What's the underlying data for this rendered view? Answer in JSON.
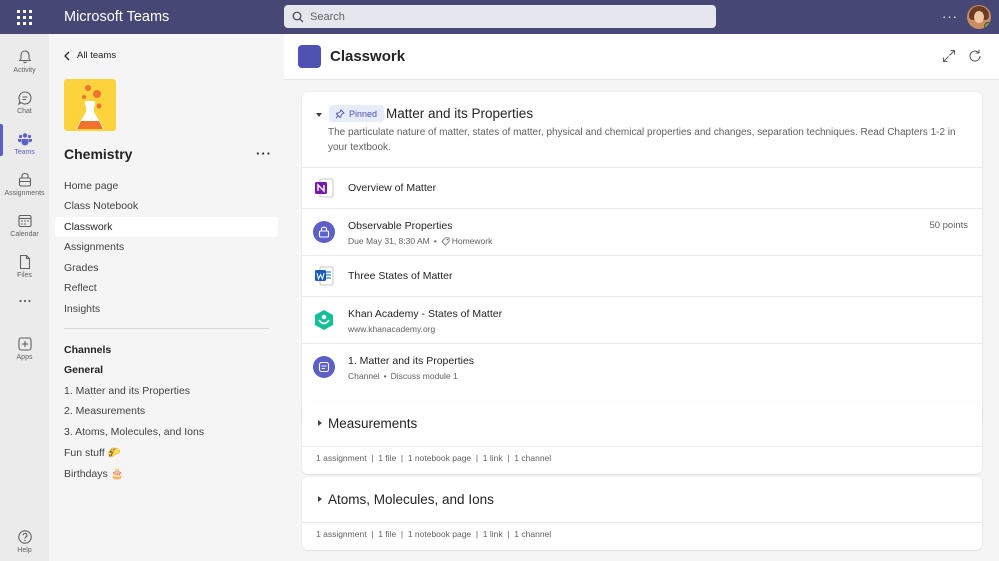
{
  "topbar": {
    "app_title": "Microsoft Teams",
    "search_placeholder": "Search",
    "more": "···",
    "accent": "#464775"
  },
  "rail": [
    {
      "label": "Activity",
      "icon": "bell-icon"
    },
    {
      "label": "Chat",
      "icon": "chat-icon"
    },
    {
      "label": "Teams",
      "icon": "teams-icon",
      "active": true
    },
    {
      "label": "Assignments",
      "icon": "assignments-icon"
    },
    {
      "label": "Calendar",
      "icon": "calendar-icon"
    },
    {
      "label": "Files",
      "icon": "files-icon"
    },
    {
      "label": "Apps",
      "icon": "apps-icon"
    },
    {
      "label": "Help",
      "icon": "help-icon"
    }
  ],
  "team": {
    "back_label": "All teams",
    "name": "Chemistry",
    "more": "···",
    "nav": [
      "Home page",
      "Class Notebook",
      "Classwork",
      "Assignments",
      "Grades",
      "Reflect",
      "Insights"
    ],
    "selected_nav": "Classwork",
    "channels_heading": "Channels",
    "channels": [
      "General",
      "1. Matter and its Properties",
      "2. Measurements",
      "3. Atoms, Molecules, and Ions",
      "Fun stuff 🌮",
      "Birthdays 🎂"
    ]
  },
  "main": {
    "title": "Classwork",
    "sections": [
      {
        "pinned_label": "Pinned",
        "title": "Matter and its Properties",
        "description": "The particulate nature of matter, states of matter, physical and chemical properties and changes, separation techniques. Read Chapters 1-2 in your textbook.",
        "items": [
          {
            "title": "Overview of Matter",
            "icon": "onenote-icon"
          },
          {
            "title": "Observable Properties",
            "sub": "Due May 31, 8:30 AM",
            "sep": "•",
            "tag": "Homework",
            "points": "50 points",
            "icon": "assignment-icon"
          },
          {
            "title": "Three States of Matter",
            "icon": "word-icon"
          },
          {
            "title": "Khan Academy - States of Matter",
            "sub": "www.khanacademy.org",
            "icon": "khan-academy-icon"
          },
          {
            "title": "1. Matter and its Properties",
            "sub": "Channel",
            "sep": "•",
            "tag": "Discuss module 1",
            "icon": "channel-icon"
          }
        ]
      },
      {
        "title": "Measurements",
        "summary": "1 assignment  |  1 file  |  1 notebook page  |  1 link  |  1 channel"
      },
      {
        "title": "Atoms, Molecules, and Ions",
        "summary": "1 assignment  |  1 file  |  1 notebook page  |  1 link  |  1 channel"
      }
    ]
  }
}
